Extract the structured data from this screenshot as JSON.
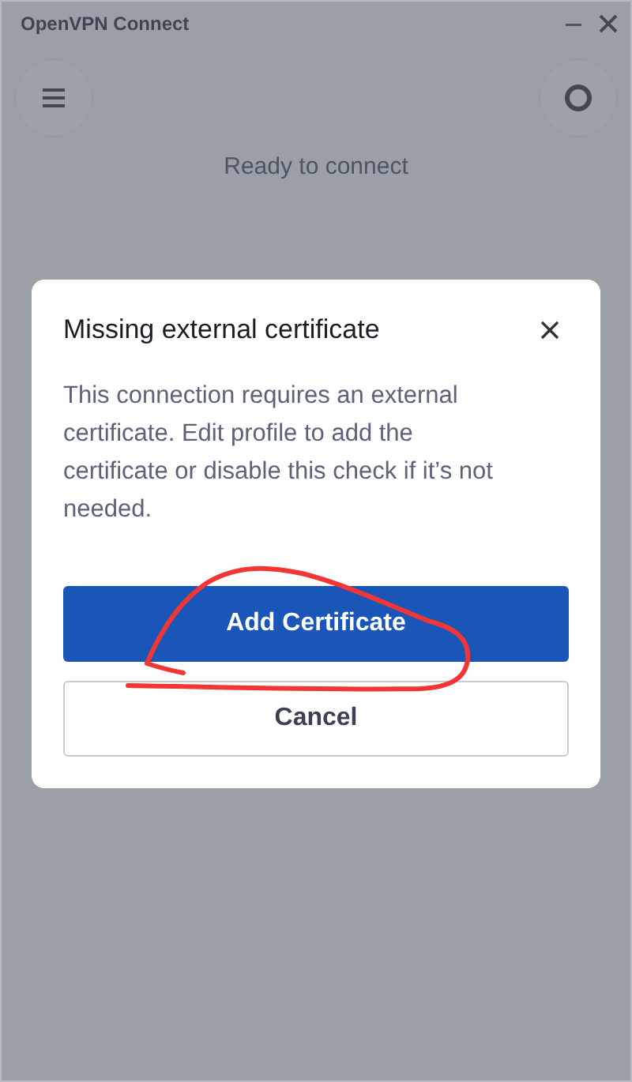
{
  "window": {
    "title": "OpenVPN Connect"
  },
  "status": "Ready to connect",
  "dialog": {
    "title": "Missing external certificate",
    "message": "This connection requires an external certificate. Edit profile to add the certificate or disable this check if it’s not needed.",
    "buttons": [
      {
        "label": "Add Certificate",
        "kind": "primary"
      },
      {
        "label": "Cancel",
        "kind": "secondary"
      }
    ]
  }
}
